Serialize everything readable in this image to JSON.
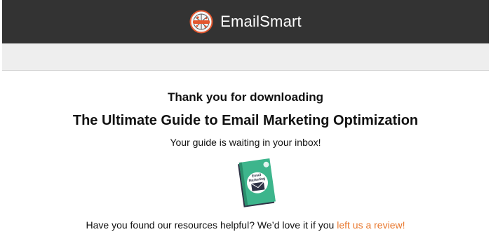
{
  "header": {
    "brand_name": "EmailSmart",
    "logo_icon": "emailsmart-logo-icon",
    "background": "#333333"
  },
  "main": {
    "thank_you": "Thank you for downloading",
    "guide_title": "The Ultimate Guide to Email Marketing Optimization",
    "waiting_text": "Your guide is waiting in your inbox!",
    "book_cover": {
      "icon": "ebook-cover-icon",
      "title_line_1": "Email",
      "title_line_2": "Marketing",
      "accent": "#3db58c"
    },
    "review_prompt": "Have you found our resources helpful? We’d love it if you",
    "review_link": "left us a review!",
    "link_color": "#e8762b"
  }
}
